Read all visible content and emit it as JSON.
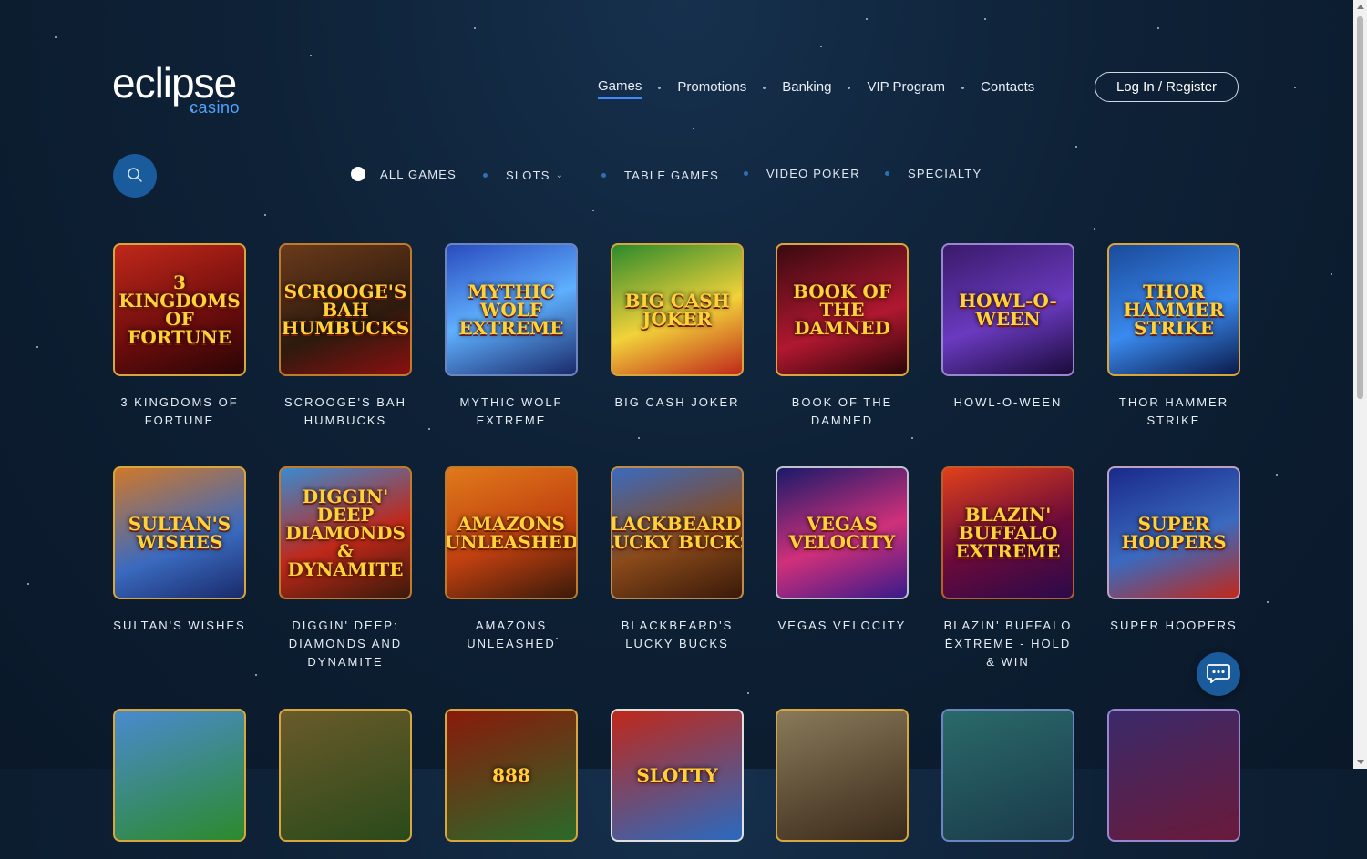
{
  "logo": {
    "main": "eclipse",
    "sub": "casino"
  },
  "nav": [
    {
      "label": "Games",
      "active": true
    },
    {
      "label": "Promotions"
    },
    {
      "label": "Banking"
    },
    {
      "label": "VIP Program"
    },
    {
      "label": "Contacts"
    }
  ],
  "login_label": "Log In / Register",
  "filters": [
    {
      "label": "ALL GAMES",
      "active": true
    },
    {
      "label": "SLOTS",
      "dropdown": true
    },
    {
      "label": "TABLE GAMES"
    },
    {
      "label": "VIDEO POKER"
    },
    {
      "label": "SPECIALTY"
    }
  ],
  "colors": {
    "accent": "#1a5b9c",
    "background": "#0e2136",
    "gold_border": "#d8a63a"
  },
  "games": [
    {
      "title": "3 KINGDOMS OF FORTUNE",
      "art": "3 KINGDOMS OF FORTUNE"
    },
    {
      "title": "SCROOGE'S BAH HUMBUCKS",
      "art": "Scrooge's BAH HUMBUCKS"
    },
    {
      "title": "MYTHIC WOLF EXTREME",
      "art": "MYTHIC WOLF EXTREME"
    },
    {
      "title": "BIG CASH JOKER",
      "art": "BIG CASH Joker"
    },
    {
      "title": "BOOK OF THE DAMNED",
      "art": "BOOK OF THE DAMNED"
    },
    {
      "title": "HOWL-O-WEEN",
      "art": "HOWL-O-WEEN"
    },
    {
      "title": "THOR HAMMER STRIKE",
      "art": "THOR HAMMER STRIKE"
    },
    {
      "title": "SULTAN'S WISHES",
      "art": "SULTAN'S WISHES"
    },
    {
      "title": "DIGGIN' DEEP: DIAMONDS AND DYNAMITE",
      "art": "DIGGIN' DEEP DIAMONDS & DYNAMITE"
    },
    {
      "title": "AMAZONS UNLEASHED",
      "art": "AMAZONS UNLEASHED"
    },
    {
      "title": "BLACKBEARD'S LUCKY BUCKS",
      "art": "BLACKBEARD'S Lucky Bucks"
    },
    {
      "title": "VEGAS VELOCITY",
      "art": "VEGAS Velocity"
    },
    {
      "title": "BLAZIN' BUFFALO EXTREME - HOLD & WIN",
      "art": "BLAZIN' BUFFALO EXTREME"
    },
    {
      "title": "SUPER HOOPERS",
      "art": "SUPER HOOPERS"
    },
    {
      "title": "",
      "art": ""
    },
    {
      "title": "",
      "art": ""
    },
    {
      "title": "",
      "art": "888"
    },
    {
      "title": "",
      "art": "Slotty"
    },
    {
      "title": "",
      "art": ""
    },
    {
      "title": "",
      "art": ""
    },
    {
      "title": "",
      "art": ""
    }
  ]
}
